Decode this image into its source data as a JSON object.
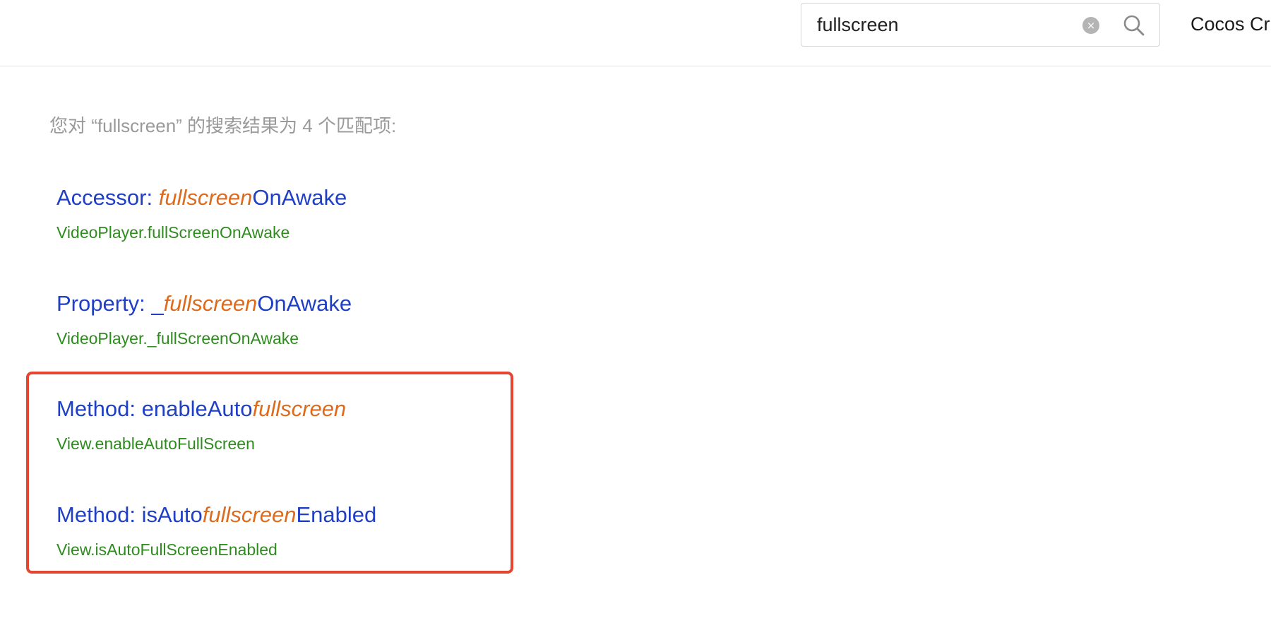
{
  "search": {
    "value": "fullscreen",
    "clear_symbol": "×"
  },
  "header": {
    "brand": "Cocos Cr"
  },
  "summary": "您对 “fullscreen” 的搜索结果为 4 个匹配项:",
  "results": [
    {
      "title_prefix": "Accessor: ",
      "title_match": "fullscreen",
      "title_suffix": "OnAwake",
      "path": "VideoPlayer.fullScreenOnAwake"
    },
    {
      "title_prefix": "Property: _",
      "title_match": "fullscreen",
      "title_suffix": "OnAwake",
      "path": "VideoPlayer._fullScreenOnAwake"
    },
    {
      "title_prefix": "Method: enableAuto",
      "title_match": "fullscreen",
      "title_suffix": "",
      "path": "View.enableAutoFullScreen"
    },
    {
      "title_prefix": "Method: isAuto",
      "title_match": "fullscreen",
      "title_suffix": "Enabled",
      "path": "View.isAutoFullScreenEnabled"
    }
  ],
  "colors": {
    "title": "#1f3fc4",
    "match": "#de6a1c",
    "path": "#2e8b1e",
    "summary": "#9a9a9a",
    "highlight_frame": "#e64531"
  },
  "icons": {
    "clear": "clear-circle-icon",
    "search": "magnifier-icon"
  }
}
